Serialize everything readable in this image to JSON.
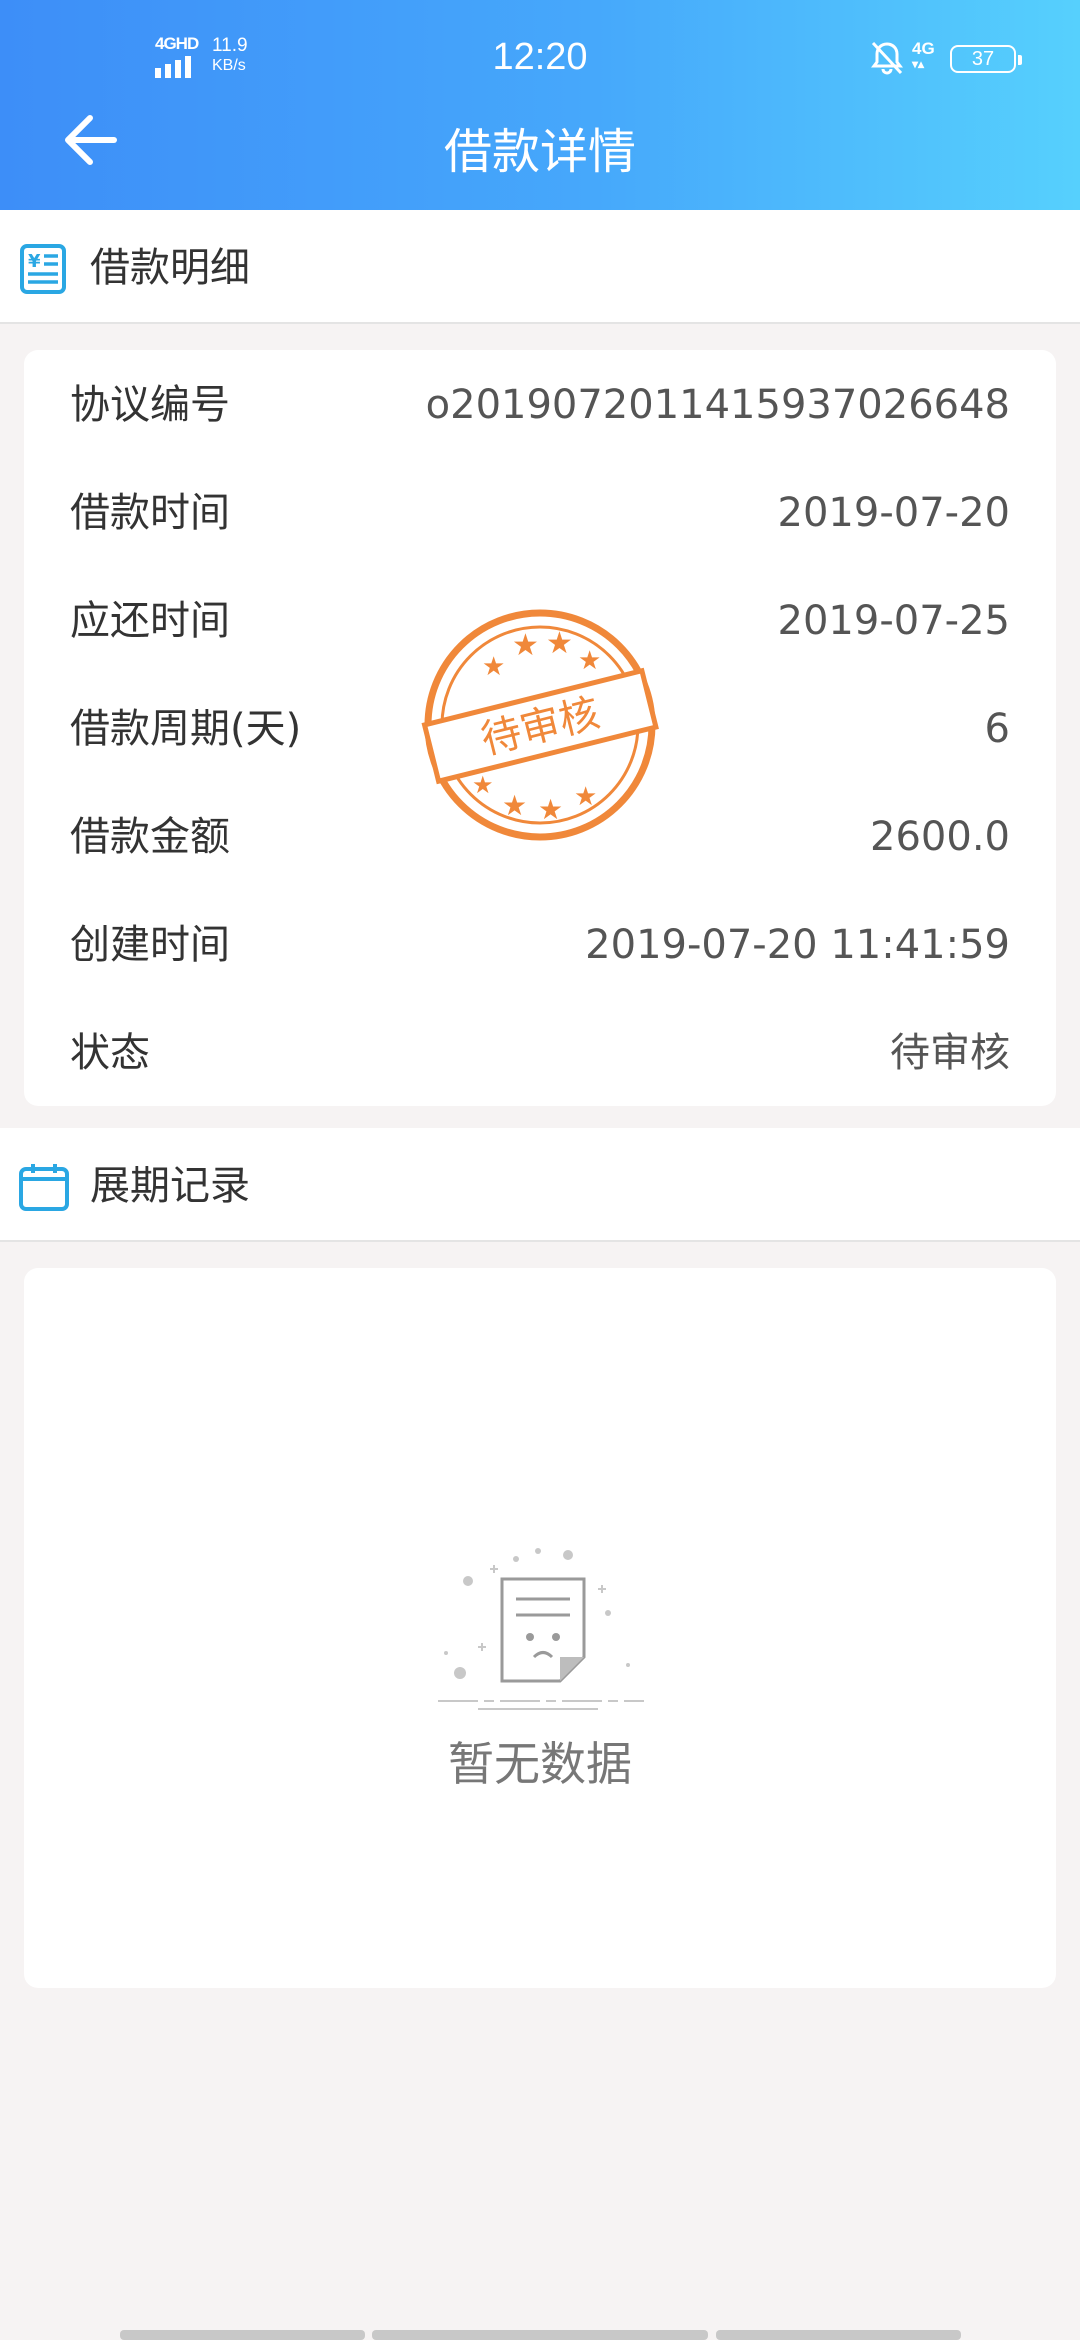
{
  "status_bar": {
    "network_label": "4GHD",
    "speed_value": "11.9",
    "speed_unit": "KB/s",
    "time": "12:20",
    "network_right": "4G",
    "battery": "37"
  },
  "header": {
    "title": "借款详情",
    "background_colors": [
      "#3d8ef8",
      "#56d0fd"
    ]
  },
  "loan_section": {
    "title": "借款明细",
    "icon": "yen-document-icon",
    "rows": [
      {
        "label": "协议编号",
        "value": "o20190720114159370266​48"
      },
      {
        "label": "借款时间",
        "value": "2019-07-20"
      },
      {
        "label": "应还时间",
        "value": "2019-07-25"
      },
      {
        "label": "借款周期(天)",
        "value": "6"
      },
      {
        "label": "借款金额",
        "value": "2600.0"
      },
      {
        "label": "创建时间",
        "value": "2019-07-20 11:41:59"
      },
      {
        "label": "状态",
        "value": "待审核"
      }
    ],
    "stamp_text": "待审核",
    "stamp_color": "#f0883a"
  },
  "extension_section": {
    "title": "展期记录",
    "icon": "calendar-icon",
    "empty_text": "暂无数据",
    "empty_icon": "empty-document-icon"
  }
}
